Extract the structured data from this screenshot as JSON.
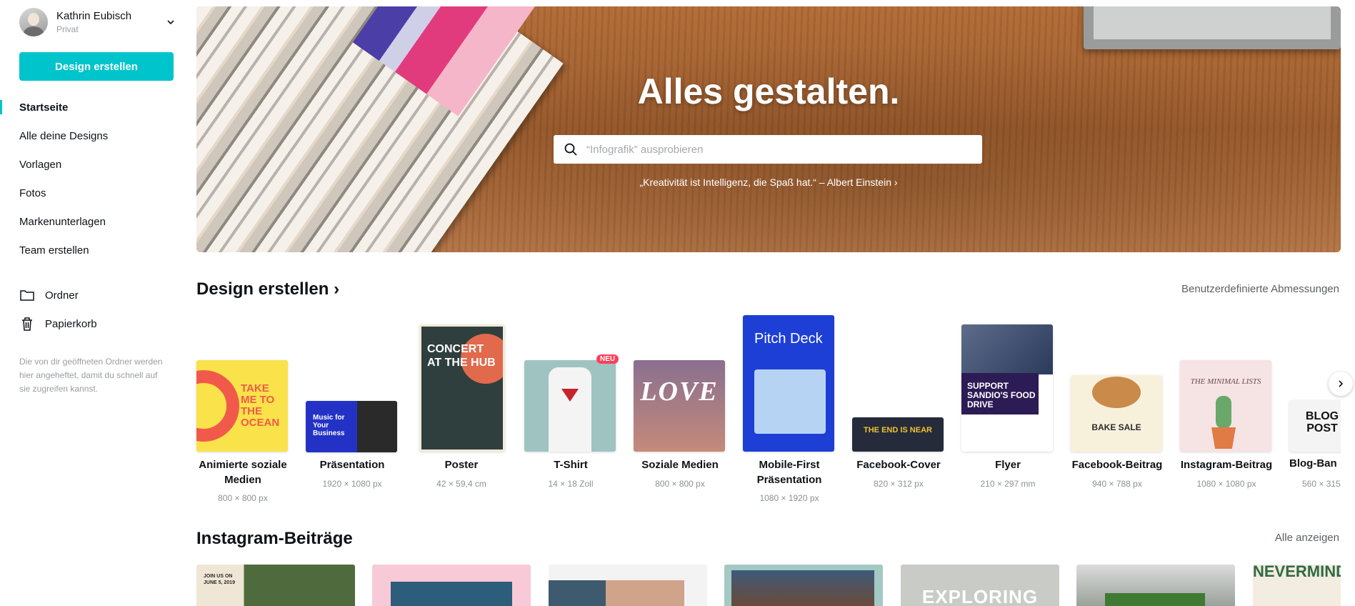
{
  "user": {
    "name": "Kathrin Eubisch",
    "type": "Privat"
  },
  "sidebar": {
    "create_label": "Design erstellen",
    "nav": [
      {
        "label": "Startseite"
      },
      {
        "label": "Alle deine Designs"
      },
      {
        "label": "Vorlagen"
      },
      {
        "label": "Fotos"
      },
      {
        "label": "Markenunterlagen"
      },
      {
        "label": "Team erstellen"
      }
    ],
    "folders": {
      "label": "Ordner"
    },
    "trash": {
      "label": "Papierkorb"
    },
    "hint": "Die von dir geöffneten Ordner werden hier angeheftet, damit du schnell auf sie zugreifen kannst."
  },
  "hero": {
    "title": "Alles gestalten.",
    "search_placeholder": "“Infografik” ausprobieren",
    "quote": "„Kreativität ist Intelligenz, die Spaß hat.“ – Albert Einstein ›"
  },
  "design_section": {
    "title": "Design erstellen ›",
    "custom_link": "Benutzerdefinierte Abmessungen",
    "items": [
      {
        "label": "Animierte soziale Medien",
        "dims": "800 × 800 px",
        "thumb_text": "TAKE ME TO THE OCEAN"
      },
      {
        "label": "Präsentation",
        "dims": "1920 × 1080 px",
        "thumb_text": "Music for Your Business"
      },
      {
        "label": "Poster",
        "dims": "42 × 59,4 cm",
        "thumb_text": "CONCERT AT THE HUB"
      },
      {
        "label": "T-Shirt",
        "dims": "14 × 18 Zoll",
        "badge": "NEU"
      },
      {
        "label": "Soziale Medien",
        "dims": "800 × 800 px",
        "thumb_text": "LOVE"
      },
      {
        "label": "Mobile-First Präsentation",
        "dims": "1080 × 1920 px",
        "thumb_text": "Pitch Deck"
      },
      {
        "label": "Facebook-Cover",
        "dims": "820 × 312 px",
        "thumb_text": "THE END IS NEAR"
      },
      {
        "label": "Flyer",
        "dims": "210 × 297 mm",
        "thumb_text": "SUPPORT SANDIO'S FOOD DRIVE"
      },
      {
        "label": "Facebook-Beitrag",
        "dims": "940 × 788 px",
        "thumb_text": "BAKE SALE"
      },
      {
        "label": "Instagram-Beitrag",
        "dims": "1080 × 1080 px",
        "thumb_text": "THE MINIMAL LISTS"
      },
      {
        "label": "Blog-Ban",
        "dims": "560 × 315",
        "thumb_text": "BLOG POST"
      }
    ]
  },
  "instagram_section": {
    "title": "Instagram-Beiträge",
    "all_link": "Alle anzeigen",
    "thumb_texts": [
      "JOIN US ON JUNE 5, 2019",
      "EXPLORING",
      "NEVERMINDER"
    ]
  },
  "colors": {
    "accent": "#00c4cc",
    "badge": "#ff3f5a"
  }
}
